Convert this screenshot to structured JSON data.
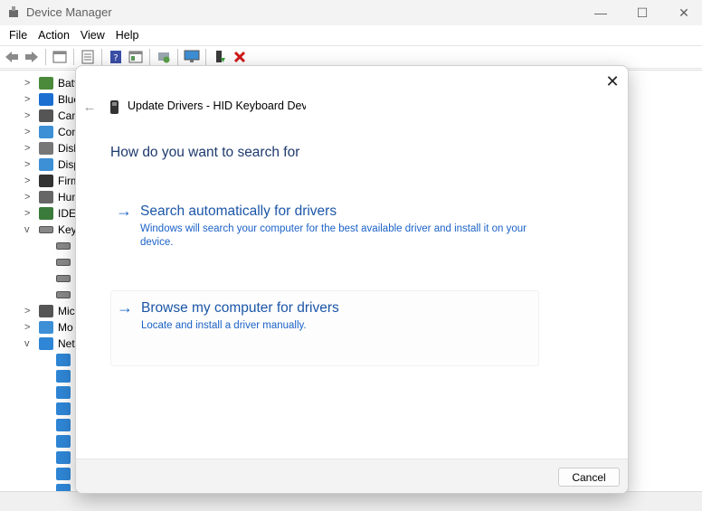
{
  "window": {
    "title": "Device Manager",
    "minimize": "—",
    "maximize": "☐",
    "close": "✕"
  },
  "menubar": {
    "items": [
      {
        "label": "File"
      },
      {
        "label": "Action"
      },
      {
        "label": "View"
      },
      {
        "label": "Help"
      }
    ]
  },
  "toolbar": {
    "buttons": [
      "back-icon",
      "forward-icon",
      "properties-icon",
      "list-icon",
      "help-icon",
      "view-icon",
      "scan-hardware-icon",
      "monitor-icon",
      "update-driver-icon",
      "uninstall-icon"
    ]
  },
  "tree": {
    "rows": [
      {
        "chev": ">",
        "label": "Batt",
        "icon": "battery-icon",
        "color": "#4a8a3a"
      },
      {
        "chev": ">",
        "label": "Blue",
        "icon": "bluetooth-icon",
        "color": "#1a6fd1"
      },
      {
        "chev": ">",
        "label": "Cam",
        "icon": "camera-icon",
        "color": "#555555"
      },
      {
        "chev": ">",
        "label": "Con",
        "icon": "computer-icon",
        "color": "#3d8fd6"
      },
      {
        "chev": ">",
        "label": "Disk",
        "icon": "disk-icon",
        "color": "#777777"
      },
      {
        "chev": ">",
        "label": "Disp",
        "icon": "display-icon",
        "color": "#3d8fd6"
      },
      {
        "chev": ">",
        "label": "Firm",
        "icon": "firmware-icon",
        "color": "#333333"
      },
      {
        "chev": ">",
        "label": "Hum",
        "icon": "hid-icon",
        "color": "#666666"
      },
      {
        "chev": ">",
        "label": "IDE",
        "icon": "ide-icon",
        "color": "#3a7a3a"
      },
      {
        "chev": "v",
        "label": "Key",
        "icon": "keyboard-icon",
        "color": "#888888"
      },
      {
        "chev": "",
        "label": "",
        "icon": "keyboard-icon",
        "color": "#888888"
      },
      {
        "chev": "",
        "label": "",
        "icon": "keyboard-icon",
        "color": "#888888"
      },
      {
        "chev": "",
        "label": "",
        "icon": "keyboard-icon",
        "color": "#888888"
      },
      {
        "chev": "",
        "label": "",
        "icon": "keyboard-icon",
        "color": "#888888"
      },
      {
        "chev": ">",
        "label": "Mic",
        "icon": "mouse-icon",
        "color": "#555555"
      },
      {
        "chev": ">",
        "label": "Mo",
        "icon": "monitor-icon",
        "color": "#3d8fd6"
      },
      {
        "chev": "v",
        "label": "Net",
        "icon": "network-icon",
        "color": "#2f86d6"
      }
    ],
    "network_children": 9
  },
  "dialog": {
    "close": "✕",
    "back": "←",
    "heading": "Update Drivers - HID Keyboard Device",
    "question": "How do you want to search for",
    "option1": {
      "title": "Search automatically for drivers",
      "description": "Windows will search your computer for the best available driver and install it on your device."
    },
    "option2": {
      "title": "Browse my computer for drivers",
      "description": "Locate and install a driver manually."
    },
    "arrow": "→",
    "cancel_label": "Cancel"
  }
}
